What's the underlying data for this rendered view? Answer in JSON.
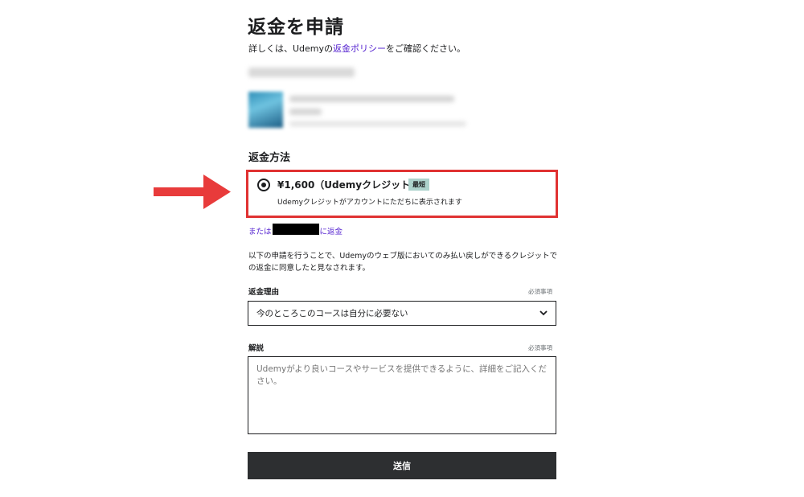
{
  "page": {
    "title": "返金を申請",
    "intro_prefix": "詳しくは、Udemyの",
    "intro_link": "返金ポリシー",
    "intro_suffix": "をご確認ください。"
  },
  "refund_method": {
    "heading": "返金方法",
    "option_title": "¥1,600（Udemyクレジット）",
    "option_badge": "最短",
    "option_description": "Udemyクレジットがアカウントにただちに表示されます",
    "or_prefix": "または",
    "or_suffix": "に返金"
  },
  "agreement_text": "以下の申請を行うことで、Udemyのウェブ版においてのみ払い戻しができるクレジットでの返金に同意したと見なされます。",
  "reason": {
    "label": "返金理由",
    "required": "必須事項",
    "selected": "今のところこのコースは自分に必要ない"
  },
  "comment": {
    "label": "解説",
    "required": "必須事項",
    "placeholder": "Udemyがより良いコースやサービスを提供できるように、詳細をご記入ください。"
  },
  "submit_label": "送信",
  "colors": {
    "highlight_border": "#e03232",
    "arrow": "#e83b3b",
    "link": "#5624d0",
    "badge": "#acd2cc",
    "submit_bg": "#2d2f31"
  },
  "icons": [
    "radio-selected-icon",
    "chevron-down-icon",
    "arrow-right-icon"
  ]
}
